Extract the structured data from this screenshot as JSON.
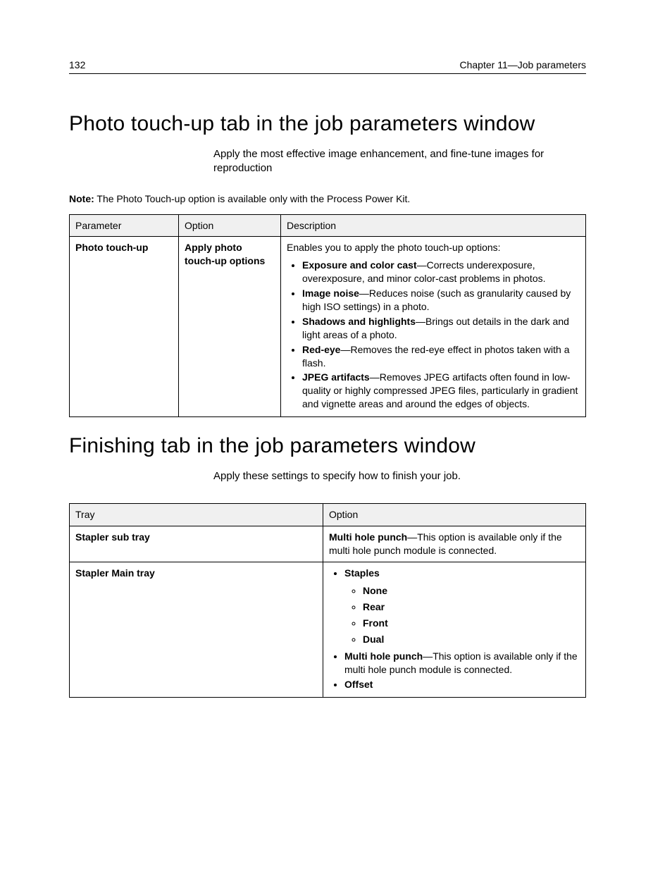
{
  "header": {
    "page_number": "132",
    "chapter": "Chapter 11—Job parameters"
  },
  "section1": {
    "heading": "Photo touch-up tab in the job parameters window",
    "subtitle": "Apply the most effective image enhancement, and fine-tune images for reproduction",
    "note_label": "Note:",
    "note_text": " The Photo Touch-up option is available only with the Process Power Kit.",
    "table": {
      "headers": {
        "c1": "Parameter",
        "c2": "Option",
        "c3": "Description"
      },
      "row": {
        "parameter": "Photo touch-up",
        "option": "Apply photo touch-up options",
        "desc_intro": "Enables you to apply the photo touch-up options:",
        "bullets": [
          {
            "term": "Exposure and color cast",
            "rest": "—Corrects underexposure, overexposure, and minor color-cast problems in photos."
          },
          {
            "term": "Image noise",
            "rest": "—Reduces noise (such as granularity caused by high ISO settings) in a photo."
          },
          {
            "term": "Shadows and highlights",
            "rest": "—Brings out details in the dark and light areas of a photo."
          },
          {
            "term": "Red-eye",
            "rest": "—Removes the red-eye effect in photos taken with a flash."
          },
          {
            "term": "JPEG artifacts",
            "rest": "—Removes JPEG artifacts often found in low-quality or highly compressed JPEG files, particularly in gradient and vignette areas and around the edges of objects."
          }
        ]
      }
    }
  },
  "section2": {
    "heading": "Finishing tab in the job parameters window",
    "subtitle": "Apply these settings to specify how to finish your job.",
    "table": {
      "headers": {
        "c1": "Tray",
        "c2": "Option"
      },
      "rows": [
        {
          "tray": "Stapler sub tray",
          "option_term": "Multi hole punch",
          "option_rest": "—This option is available only if the multi hole punch module is connected."
        },
        {
          "tray": "Stapler Main tray",
          "staples_label": "Staples",
          "staple_options": [
            "None",
            "Rear",
            "Front",
            "Dual"
          ],
          "mhp_term": "Multi hole punch",
          "mhp_rest": "—This option is available only if the multi hole punch module is connected.",
          "offset": "Offset"
        }
      ]
    }
  }
}
